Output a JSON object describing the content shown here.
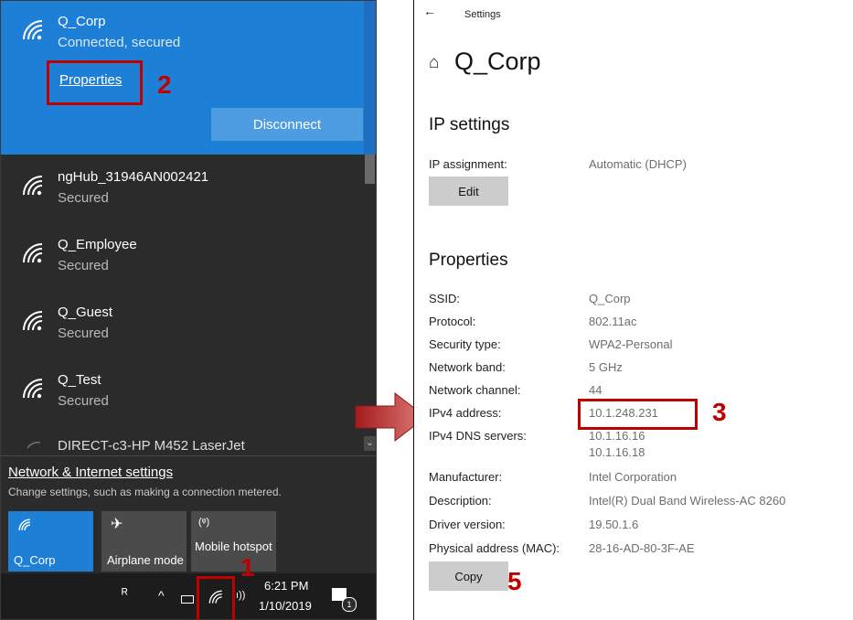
{
  "flyout": {
    "connected": {
      "name": "Q_Corp",
      "status": "Connected, secured",
      "properties_link": "Properties",
      "disconnect_label": "Disconnect"
    },
    "networks": [
      {
        "name": "ngHub_31946AN002421",
        "status": "Secured"
      },
      {
        "name": "Q_Employee",
        "status": "Secured"
      },
      {
        "name": "Q_Guest",
        "status": "Secured"
      },
      {
        "name": "Q_Test",
        "status": "Secured"
      },
      {
        "name": "DIRECT-c3-HP M452 LaserJet",
        "status": ""
      }
    ],
    "settings_link": "Network & Internet settings",
    "settings_desc": "Change settings, such as making a connection metered.",
    "tiles": [
      {
        "label": "Q_Corp",
        "icon": "wifi-icon",
        "active": true
      },
      {
        "label": "Airplane mode",
        "icon": "airplane-icon",
        "active": false
      },
      {
        "label": "Mobile hotspot",
        "icon": "hotspot-icon",
        "active": false
      }
    ],
    "taskbar": {
      "time": "6:21 PM",
      "date": "1/10/2019",
      "notification_count": "1"
    }
  },
  "settings": {
    "title_bar": "Settings",
    "page_title": "Q_Corp",
    "ip_section": "IP settings",
    "ip_assignment_label": "IP assignment:",
    "ip_assignment_value": "Automatic (DHCP)",
    "edit_button": "Edit",
    "properties_section": "Properties",
    "properties": [
      {
        "label": "SSID:",
        "value": "Q_Corp"
      },
      {
        "label": "Protocol:",
        "value": "802.11ac"
      },
      {
        "label": "Security type:",
        "value": "WPA2-Personal"
      },
      {
        "label": "Network band:",
        "value": "5 GHz"
      },
      {
        "label": "Network channel:",
        "value": "44"
      },
      {
        "label": "IPv4 address:",
        "value": "10.1.248.231"
      },
      {
        "label": "IPv4 DNS servers:",
        "value": "10.1.16.16",
        "value2": "10.1.16.18"
      },
      {
        "label": "Manufacturer:",
        "value": "Intel Corporation"
      },
      {
        "label": "Description:",
        "value": "Intel(R) Dual Band Wireless-AC 8260"
      },
      {
        "label": "Driver version:",
        "value": "19.50.1.6"
      },
      {
        "label": "Physical address (MAC):",
        "value": "28-16-AD-80-3F-AE"
      }
    ],
    "copy_button": "Copy"
  },
  "annotations": {
    "step1": "1",
    "step2": "2",
    "step3": "3",
    "step5": "5"
  },
  "colors": {
    "accent": "#1e7fd6",
    "annotation": "#c00000",
    "flyout_bg": "#2b2b2b"
  }
}
